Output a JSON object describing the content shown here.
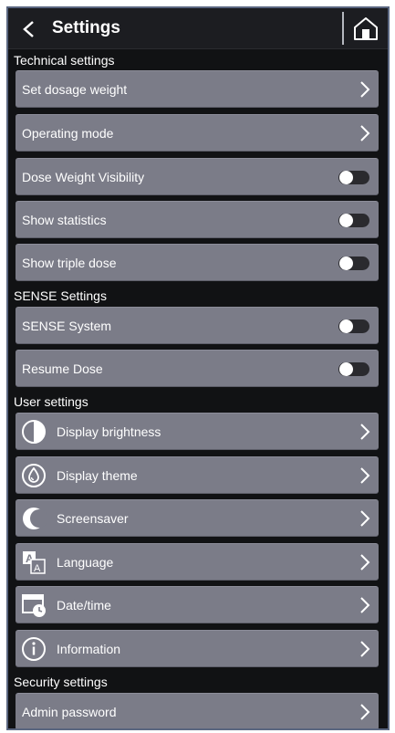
{
  "header": {
    "title": "Settings",
    "back_icon": "chevron-left-icon",
    "home_icon": "home-icon"
  },
  "sections": {
    "technical": {
      "title": "Technical settings",
      "items": {
        "set_dosage_weight": "Set dosage weight",
        "operating_mode": "Operating mode",
        "dose_weight_visibility": {
          "label": "Dose Weight Visibility",
          "enabled": false
        },
        "show_statistics": {
          "label": "Show statistics",
          "enabled": false
        },
        "show_triple_dose": {
          "label": "Show triple dose",
          "enabled": false
        }
      }
    },
    "sense": {
      "title": "SENSE Settings",
      "items": {
        "sense_system": {
          "label": "SENSE System",
          "enabled": false
        },
        "resume_dose": {
          "label": "Resume Dose",
          "enabled": false
        }
      }
    },
    "user": {
      "title": "User settings",
      "items": {
        "display_brightness": {
          "label": "Display brightness",
          "icon": "brightness-icon"
        },
        "display_theme": {
          "label": "Display theme",
          "icon": "theme-drop-icon"
        },
        "screensaver": {
          "label": "Screensaver",
          "icon": "moon-icon"
        },
        "language": {
          "label": "Language",
          "icon": "language-icon"
        },
        "date_time": {
          "label": "Date/time",
          "icon": "calendar-clock-icon"
        },
        "information": {
          "label": "Information",
          "icon": "info-icon"
        }
      }
    },
    "security": {
      "title": "Security settings",
      "items": {
        "admin_password": "Admin password"
      }
    }
  },
  "colors": {
    "background": "#111214",
    "row": "#7b7c88",
    "text": "#ffffff",
    "toggle_off": "#2a2a2e"
  }
}
